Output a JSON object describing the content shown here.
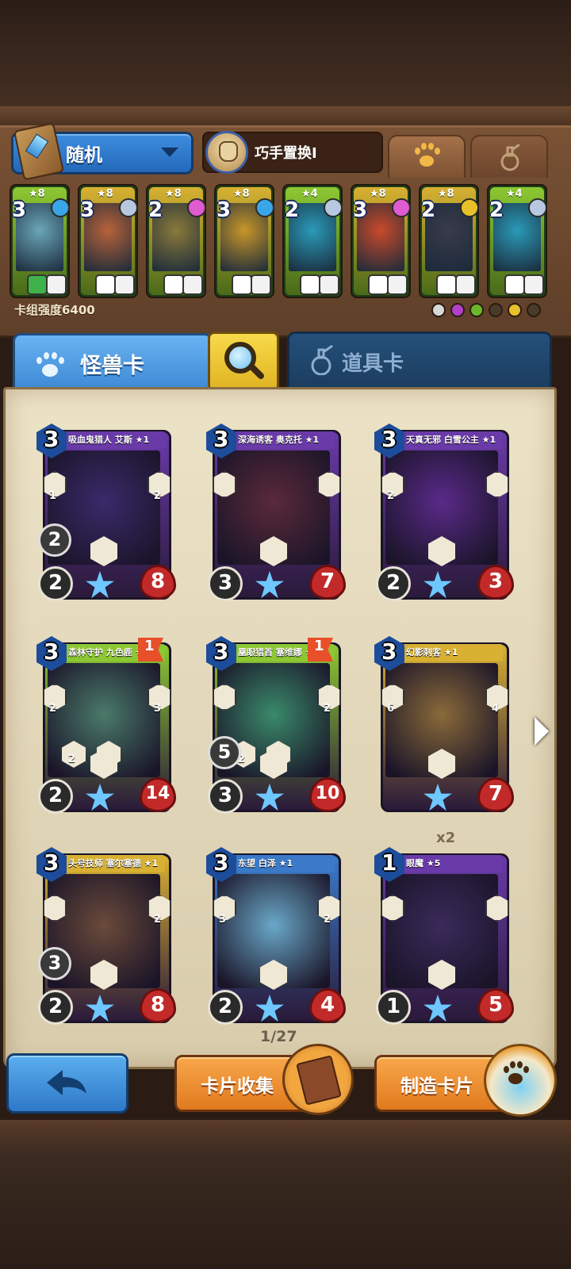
{
  "header": {
    "deck_selector_label": "随机",
    "skill_label": "巧手置换I",
    "tabs": [
      {
        "icon": "paw-icon",
        "active": true
      },
      {
        "icon": "potion-icon",
        "active": false
      }
    ]
  },
  "deck": {
    "cards": [
      {
        "cost": "3",
        "stars": "★8",
        "gem": "#3aa6e8",
        "frame": "#8cc832",
        "art": "#6aa6b8",
        "trait": "#3fb24a"
      },
      {
        "cost": "3",
        "stars": "★8",
        "gem": "#b8c8e0",
        "frame": "#d8b032",
        "art": "#b8623a",
        "trait": "#ffffff"
      },
      {
        "cost": "2",
        "stars": "★8",
        "gem": "#e05ad0",
        "frame": "#d8b032",
        "art": "#8a7a3a",
        "trait": "#ffffff"
      },
      {
        "cost": "3",
        "stars": "★8",
        "gem": "#3aa6e8",
        "frame": "#d8b032",
        "art": "#c8962a",
        "trait": "#ffffff"
      },
      {
        "cost": "2",
        "stars": "★4",
        "gem": "#b8c8e0",
        "frame": "#8cc832",
        "art": "#2a9ab8",
        "trait": "#ffffff"
      },
      {
        "cost": "3",
        "stars": "★8",
        "gem": "#e05ad0",
        "frame": "#d8b032",
        "art": "#c84a2a",
        "trait": "#ffffff"
      },
      {
        "cost": "2",
        "stars": "★8",
        "gem": "#e8c02a",
        "frame": "#d8b032",
        "art": "#3a3a4a",
        "trait": "#ffffff"
      },
      {
        "cost": "2",
        "stars": "★4",
        "gem": "#b8c8e0",
        "frame": "#8cc832",
        "art": "#2a9ab8",
        "trait": "#ffffff"
      }
    ],
    "power_label": "卡组强度6400",
    "race_icons": [
      "#d8d8d8",
      "#b040c8",
      "#6ab82a",
      "#4a3a2a",
      "#e8c02a",
      "#4a3a2a"
    ]
  },
  "tabs": {
    "monster_label": "怪兽卡",
    "item_label": "道具卡"
  },
  "cards": [
    {
      "name": "吸血鬼猎人 艾斯 ★1",
      "cost": "3",
      "attack": "2",
      "hp": "8",
      "mana": "2",
      "left_badge": "1",
      "right_badge": "2",
      "body": "#6a3aa8",
      "art": "#3a2a6a",
      "flag": null
    },
    {
      "name": "深海诱客 奥克托 ★1",
      "cost": "3",
      "attack": "3",
      "hp": "7",
      "mana": null,
      "left_badge": "",
      "right_badge": "",
      "body": "#6a3aa8",
      "art": "#5a2a3a",
      "flag": null
    },
    {
      "name": "天真无邪 白雪公主 ★1",
      "cost": "3",
      "attack": "2",
      "hp": "3",
      "mana": null,
      "left_badge": "2",
      "right_badge": "",
      "body": "#6a3aa8",
      "art": "#5a2a8a",
      "flag": null
    },
    {
      "name": "森林守护 九色鹿 ★8",
      "cost": "3",
      "attack": "2",
      "hp": "14",
      "mana": null,
      "left_badge": "2",
      "right_badge": "3",
      "body": "#8cc832",
      "art": "#4a7a6a",
      "flag": "1",
      "lower": [
        "2",
        "2"
      ]
    },
    {
      "name": "凰眼猎首 塞维娜 ★8",
      "cost": "3",
      "attack": "3",
      "hp": "10",
      "mana": "5",
      "left_badge": "",
      "right_badge": "2",
      "body": "#8cc832",
      "art": "#3a8a6a",
      "flag": "1",
      "lower": [
        "2",
        ""
      ]
    },
    {
      "name": "幻影刺客 ★1",
      "cost": "3",
      "attack": "",
      "hp": "7",
      "mana": null,
      "left_badge": "6",
      "right_badge": "4",
      "body": "#d8b032",
      "art": "#8a6a3a",
      "flag": null
    },
    {
      "name": "头号技师 塞尔塞德 ★1",
      "cost": "3",
      "attack": "2",
      "hp": "8",
      "mana": "3",
      "left_badge": "",
      "right_badge": "2",
      "body": "#d8b032",
      "art": "#6a4a3a",
      "flag": null
    },
    {
      "name": "东望 白泽 ★1",
      "cost": "3",
      "attack": "2",
      "hp": "4",
      "mana": null,
      "left_badge": "3",
      "right_badge": "2",
      "body": "#3a7ac8",
      "art": "#6aa8c8",
      "flag": null
    },
    {
      "name": "眼魔 ★5",
      "cost": "1",
      "attack": "1",
      "hp": "5",
      "mana": null,
      "left_badge": "",
      "right_badge": "",
      "body": "#6a3aa8",
      "art": "#3a2a5a",
      "flag": null
    }
  ],
  "copies_label": "x2",
  "pagination": "1/27",
  "footer": {
    "collect_label": "卡片收集",
    "craft_label": "制造卡片"
  }
}
